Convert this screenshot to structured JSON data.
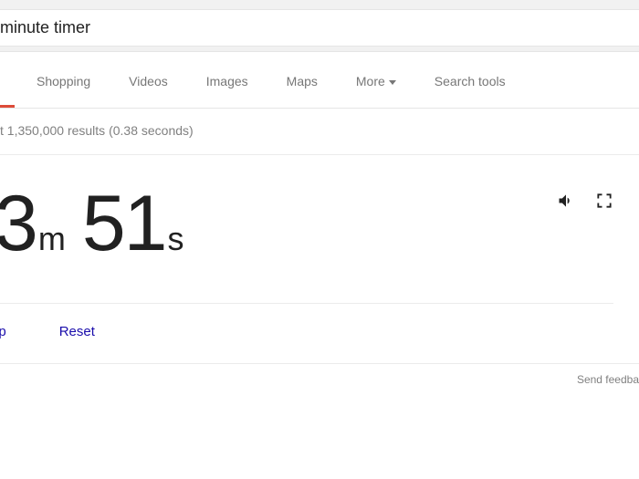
{
  "search": {
    "query": "minute timer"
  },
  "tabs": {
    "shopping": "Shopping",
    "videos": "Videos",
    "images": "Images",
    "maps": "Maps",
    "more": "More",
    "tools": "Search tools"
  },
  "stats": {
    "text": "t 1,350,000 results (0.38 seconds)"
  },
  "timer": {
    "minutes": "3",
    "minutes_unit": "m",
    "seconds": "51",
    "seconds_unit": "s"
  },
  "controls": {
    "stop": "op",
    "reset": "Reset"
  },
  "footer": {
    "feedback": "Send feedba"
  }
}
